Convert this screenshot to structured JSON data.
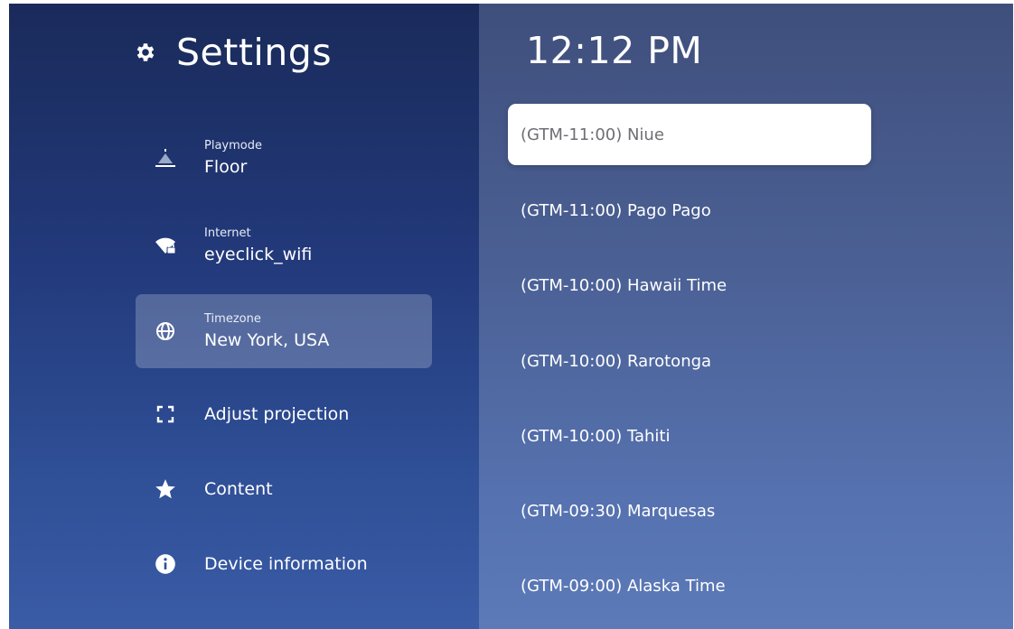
{
  "header": {
    "title": "Settings",
    "icon": "gear-icon"
  },
  "menu": {
    "playmode": {
      "caption": "Playmode",
      "value": "Floor",
      "icon": "floor-icon"
    },
    "internet": {
      "caption": "Internet",
      "value": "eyeclick_wifi",
      "icon": "wifi-lock-icon"
    },
    "timezone": {
      "caption": "Timezone",
      "value": "New York, USA",
      "icon": "globe-icon"
    },
    "adjust_projection": {
      "label": "Adjust projection",
      "icon": "frame-corners-icon"
    },
    "content": {
      "label": "Content",
      "icon": "star-icon"
    },
    "device_information": {
      "label": "Device information",
      "icon": "info-icon"
    }
  },
  "clock": {
    "time": "12:12 PM"
  },
  "timezones": [
    {
      "label": "(GTM-11:00) Niue",
      "selected": true
    },
    {
      "label": "(GTM-11:00) Pago Pago",
      "selected": false
    },
    {
      "label": "(GTM-10:00) Hawaii Time",
      "selected": false
    },
    {
      "label": "(GTM-10:00) Rarotonga",
      "selected": false
    },
    {
      "label": "(GTM-10:00) Tahiti",
      "selected": false
    },
    {
      "label": "(GTM-09:30) Marquesas",
      "selected": false
    },
    {
      "label": "(GTM-09:00) Alaska Time",
      "selected": false
    }
  ],
  "colors": {
    "left_panel_top": "#1a2a5a",
    "left_panel_bottom": "#3a5ca6",
    "right_panel_top": "#3f4f7c",
    "right_panel_bottom": "#5c7ab8",
    "selected_bg": "#ffffff",
    "selected_text": "#6e6e74"
  }
}
